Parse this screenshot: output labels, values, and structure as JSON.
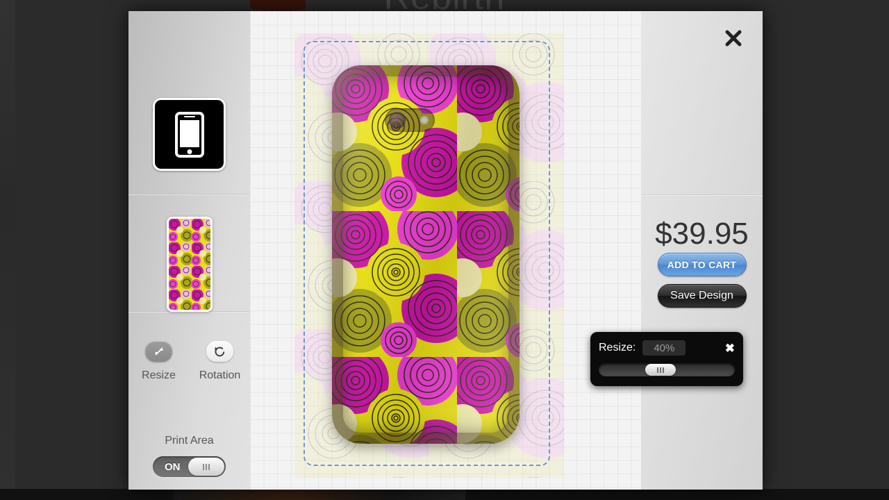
{
  "background": {
    "page_title": "Rebirth"
  },
  "modal": {
    "close_icon": "close-icon"
  },
  "sidebar": {
    "product_icon": "phone-icon",
    "design_thumbnail": "floral-design-thumbnail",
    "tools": [
      {
        "label": "Resize",
        "icon": "resize-arrows-icon",
        "active": true
      },
      {
        "label": "Rotation",
        "icon": "rotate-ccw-icon",
        "active": false
      }
    ],
    "print_area": {
      "label": "Print Area",
      "toggle_state": "ON"
    }
  },
  "canvas": {
    "print_area_border_color": "#6f93c9",
    "pattern_colors": {
      "yellow": "#e9e010",
      "olive": "#a8a61a",
      "magenta": "#cc13a8",
      "pink": "#f03cd6",
      "light_pink": "#f4b8e8",
      "cream": "#efeaa8",
      "outline": "#3a3020"
    }
  },
  "right_panel": {
    "price": "$39.95",
    "add_to_cart_label": "ADD TO CART",
    "save_design_label": "Save Design",
    "accent_color": "#5b95d8"
  },
  "resize_popup": {
    "label": "Resize:",
    "value": "40%",
    "close_icon": "close-icon",
    "slider_position_percent": 40
  }
}
